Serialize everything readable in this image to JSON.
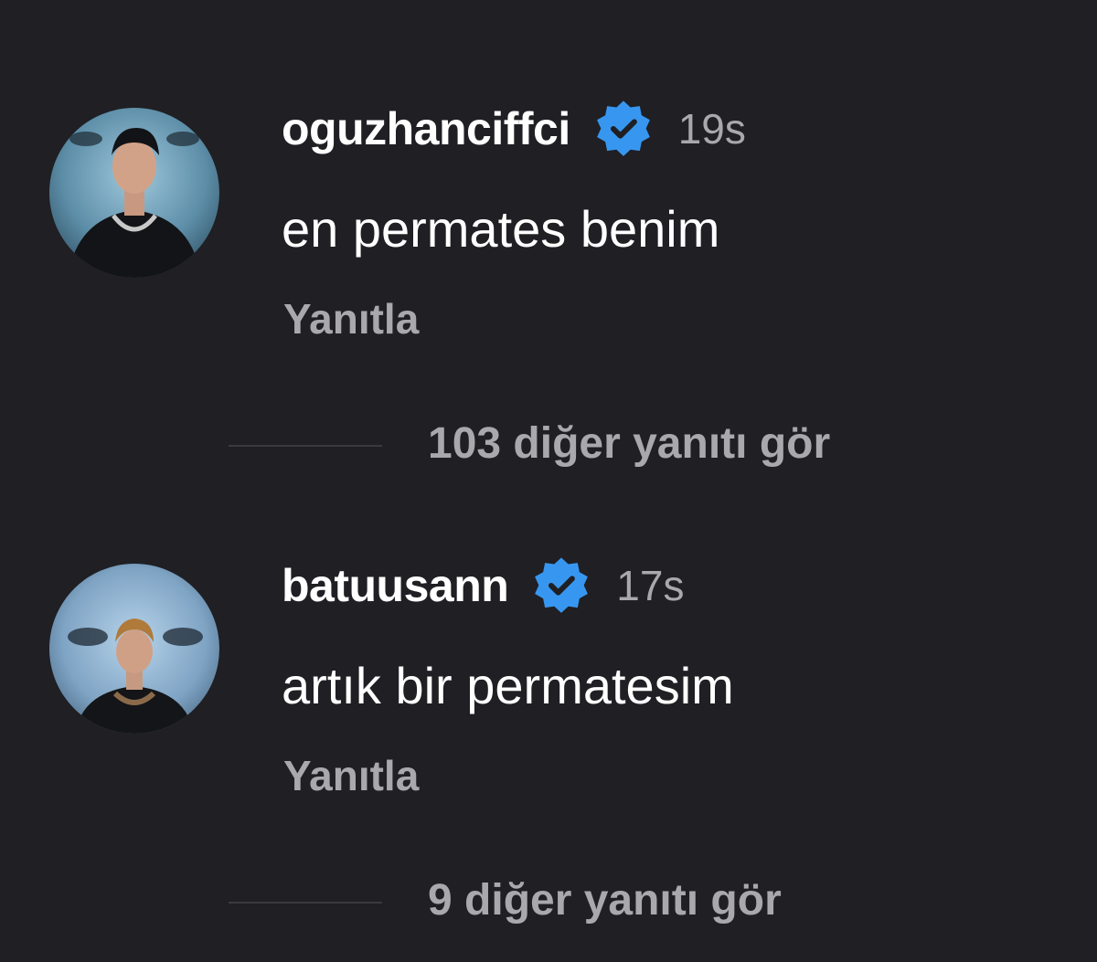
{
  "comments": [
    {
      "username": "oguzhanciffci",
      "time": "19s",
      "text": "en permates benim",
      "reply_label": "Yanıtla",
      "more_replies": "103 diğer yanıtı gör",
      "verified_icon": "verified-badge-icon"
    },
    {
      "username": "batuusann",
      "time": "17s",
      "text": "artık bir permatesim",
      "reply_label": "Yanıtla",
      "more_replies": "9 diğer yanıtı gör",
      "verified_icon": "verified-badge-icon"
    }
  ],
  "colors": {
    "background": "#1f1f24",
    "primary_text": "#ffffff",
    "secondary_text": "#a8a8ad",
    "verified_blue": "#3797f0"
  }
}
